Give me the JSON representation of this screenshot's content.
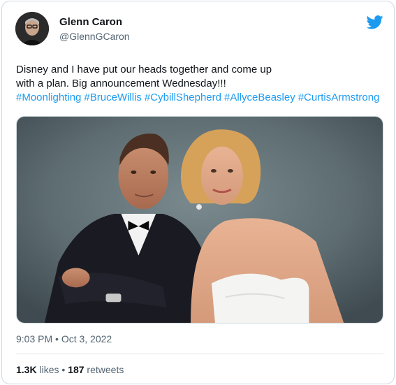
{
  "tweet": {
    "author_name": "Glenn Caron",
    "author_handle": "@GlennGCaron",
    "text_line1": "Disney and I have put our heads together and come up",
    "text_line2": "with a plan. Big announcement Wednesday!!!",
    "hashtags": [
      "#Moonlighting",
      "#BruceWillis",
      "#CybillShepherd",
      "#AllyceBeasley",
      "#CurtisArmstrong"
    ],
    "timestamp": "9:03 PM • Oct 3, 2022",
    "likes_count": "1.3K",
    "likes_label": "likes",
    "separator": "•",
    "retweets_count": "187",
    "retweets_label": "retweets"
  },
  "colors": {
    "link": "#1d9bf0",
    "twitter_brand": "#1d9bf0",
    "secondary_text": "#536471"
  },
  "icons": {
    "brand": "twitter-bird-icon"
  }
}
